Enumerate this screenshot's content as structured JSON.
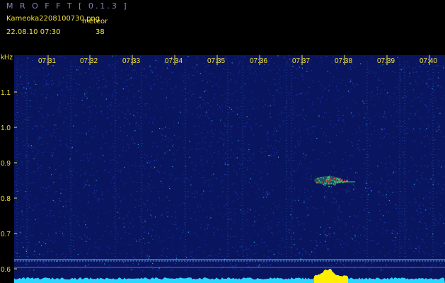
{
  "header": {
    "app_title": "M R O F F T  [ 0.1.3 ]",
    "file_name": "Kameoka2208100730.png",
    "count_label": "meteor",
    "capture_time": "22.08.10 07:30",
    "count_value": "38"
  },
  "chart_data": {
    "type": "heatmap",
    "title": "",
    "xlabel": "",
    "ylabel": "kHz",
    "x_ticks": [
      "07:31",
      "07:32",
      "07:33",
      "07:34",
      "07:35",
      "07:36",
      "07:37",
      "07:38",
      "07:39",
      "07:40"
    ],
    "y_ticks": [
      "1.1",
      "1.0",
      "0.9",
      "0.8",
      "0.7",
      "0.6"
    ],
    "y_range": [
      0.59,
      1.18
    ],
    "grid": false,
    "detections": [
      {
        "time": "07:37:36",
        "frequency_khz": 0.85
      }
    ],
    "colors": {
      "background": "#0a1560",
      "noise_low": "#1c3cb8",
      "noise_high": "#2fa3d8",
      "echo": "#3ccf6a",
      "echo_core": "#ff3b3b",
      "text": "#f3e23a",
      "level_bar": "#29d8ff",
      "level_peak": "#ffef00"
    }
  }
}
